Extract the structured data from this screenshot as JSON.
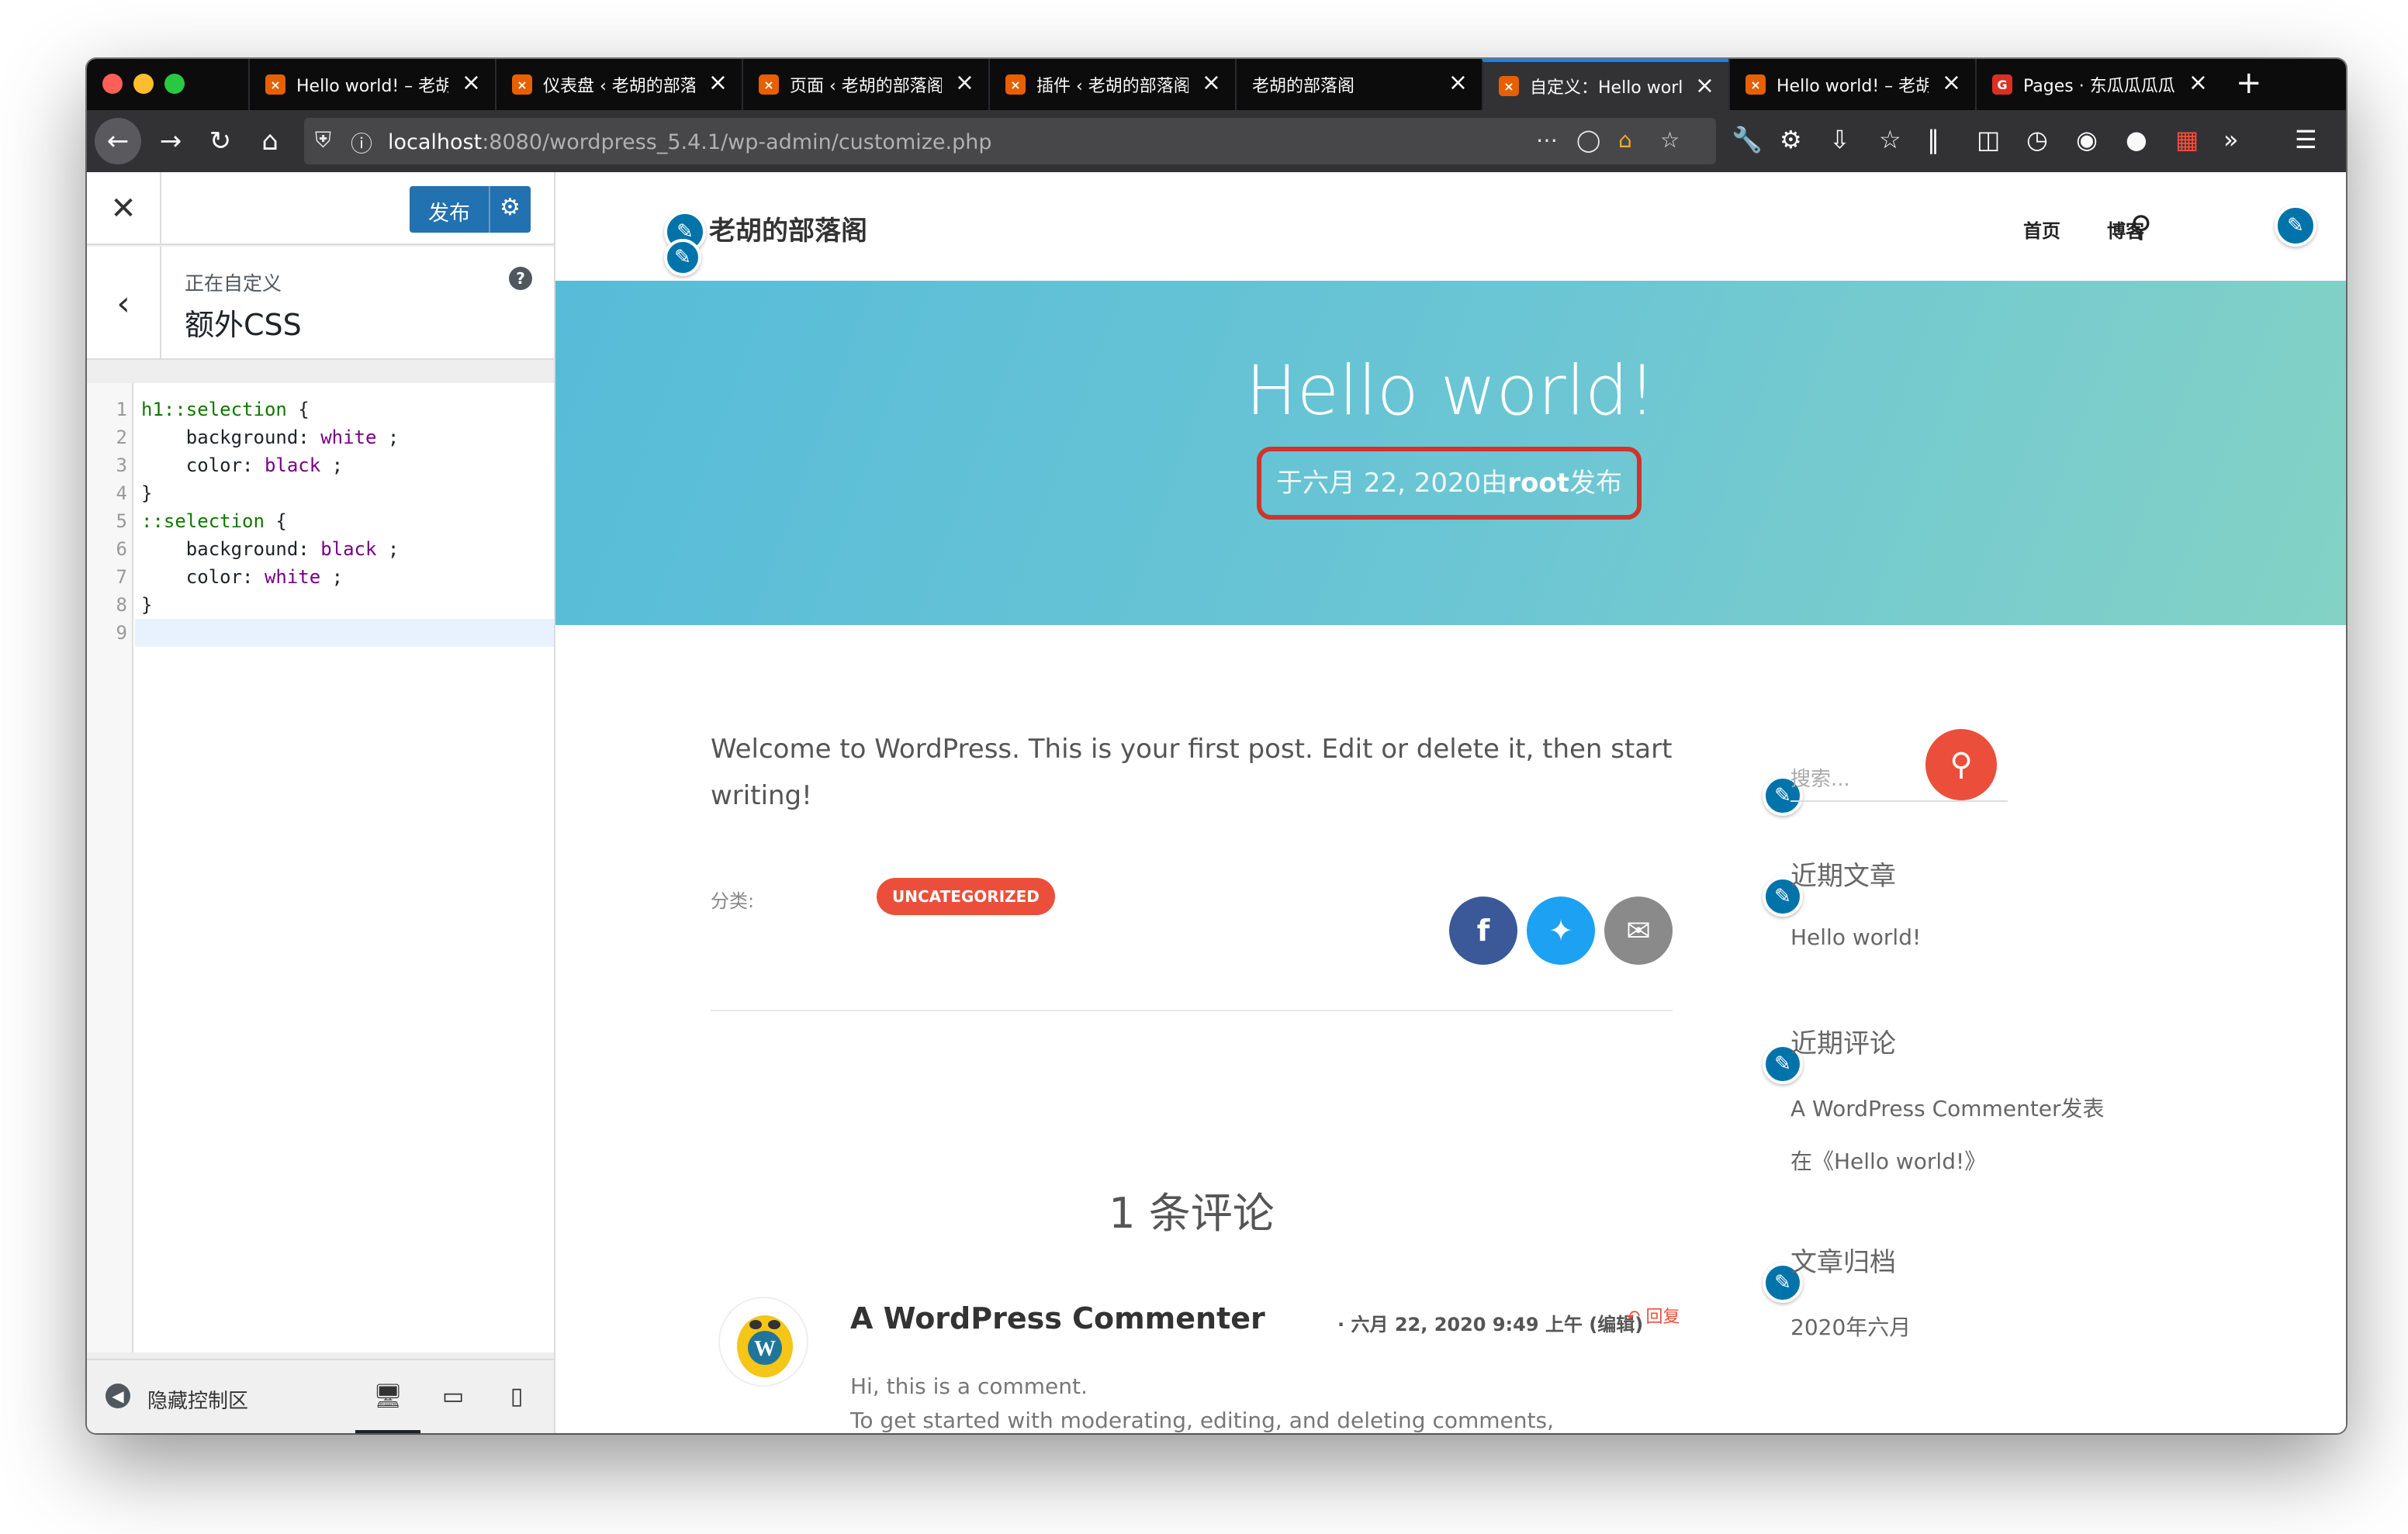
{
  "browser": {
    "tabs": [
      {
        "title": "Hello world! – 老胡",
        "active": false,
        "favicon": "xampp"
      },
      {
        "title": "仪表盘 ‹ 老胡的部落",
        "active": false,
        "favicon": "xampp"
      },
      {
        "title": "页面 ‹ 老胡的部落阁",
        "active": false,
        "favicon": "xampp"
      },
      {
        "title": "插件 ‹ 老胡的部落阁",
        "active": false,
        "favicon": "xampp"
      },
      {
        "title": "老胡的部落阁",
        "active": false,
        "favicon": "none"
      },
      {
        "title": "自定义：Hello worl",
        "active": true,
        "favicon": "xampp"
      },
      {
        "title": "Hello world! – 老胡",
        "active": false,
        "favicon": "xampp"
      },
      {
        "title": "Pages · 东瓜瓜瓜瓜",
        "active": false,
        "favicon": "gitee"
      }
    ],
    "url_host": "localhost",
    "url_rest": ":8080/wordpress_5.4.1/wp-admin/customize.php"
  },
  "customizer": {
    "publish_label": "发布",
    "section_small": "正在自定义",
    "section_title": "额外CSS",
    "help_icon": "?",
    "code_lines": [
      {
        "n": "1",
        "parts": [
          [
            "k-tag",
            "h1::selection"
          ],
          [
            "",
            "{"
          ]
        ]
      },
      {
        "n": "2",
        "parts": [
          [
            "",
            "    background:"
          ],
          [
            "k-val",
            "white"
          ],
          [
            "",
            ";"
          ]
        ]
      },
      {
        "n": "3",
        "parts": [
          [
            "",
            "    color:"
          ],
          [
            "k-val",
            "black"
          ],
          [
            "",
            ";"
          ]
        ]
      },
      {
        "n": "4",
        "parts": [
          [
            "",
            "}"
          ]
        ]
      },
      {
        "n": "5",
        "parts": [
          [
            "k-tag",
            "::selection"
          ],
          [
            "",
            "{"
          ]
        ]
      },
      {
        "n": "6",
        "parts": [
          [
            "",
            "    background:"
          ],
          [
            "k-val",
            "black"
          ],
          [
            "",
            ";"
          ]
        ]
      },
      {
        "n": "7",
        "parts": [
          [
            "",
            "    color:"
          ],
          [
            "k-val",
            "white"
          ],
          [
            "",
            ";"
          ]
        ]
      },
      {
        "n": "8",
        "parts": [
          [
            "",
            "}"
          ]
        ]
      },
      {
        "n": "9",
        "parts": []
      }
    ],
    "hide_controls_label": "隐藏控制区"
  },
  "site": {
    "title": "老胡的部落阁",
    "menu": [
      "首页",
      "博客"
    ],
    "post_title": "Hello world!",
    "meta_before": "于六月 22, 2020由",
    "meta_author": "root",
    "meta_after": "发布",
    "post_text": "Welcome to WordPress. This is your first post. Edit or delete it, then start writing!",
    "category_label": "分类:",
    "category": "UNCATEGORIZED",
    "comments_title": "1 条评论",
    "commenter": "A WordPress Commenter",
    "comment_meta": "· 六月 22, 2020 9:49 上午 (编辑)",
    "reply": "回复",
    "comment_line1": "Hi, this is a comment.",
    "comment_line2": "To get started with moderating, editing, and deleting comments,",
    "search_placeholder": "搜索...",
    "widgets": {
      "recent_posts_title": "近期文章",
      "recent_post": "Hello world!",
      "recent_comments_title": "近期评论",
      "recent_comment_line1": "A WordPress Commenter发表",
      "recent_comment_line2": "在《Hello world!》",
      "archives_title": "文章归档",
      "archive_item": "2020年六月"
    }
  },
  "colors": {
    "accent_blue": "#0073aa",
    "wp_publish": "#2271b1",
    "theme_red": "#eb4f3b",
    "highlight_box": "#d2332b",
    "facebook": "#3b5998",
    "twitter": "#1da1f2",
    "email": "#8a8a8a"
  }
}
